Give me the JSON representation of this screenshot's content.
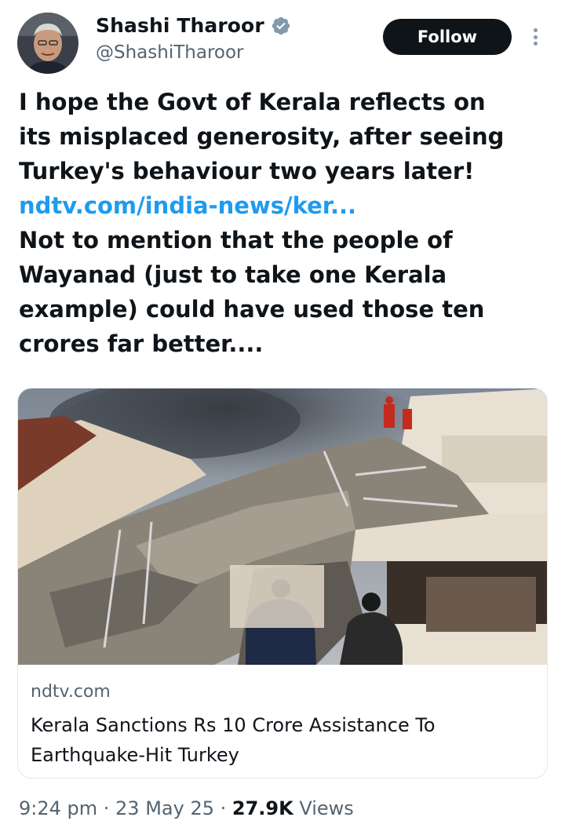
{
  "author": {
    "display_name": "Shashi Tharoor",
    "handle": "@ShashiTharoor",
    "verified_icon": "verified-badge-icon",
    "avatar_icon": "profile-photo"
  },
  "header": {
    "follow_label": "Follow",
    "more_icon": "more-options-icon"
  },
  "tweet": {
    "lines": [
      "I hope the Govt of Kerala reflects on",
      "its misplaced generosity, after seeing",
      "Turkey's behaviour two years later!"
    ],
    "link_text": "ndtv.com/india-news/ker...",
    "lines_after": [
      "Not to mention that the people of",
      "Wayanad (just to take one Kerala",
      "example) could have used those ten",
      "crores far better...."
    ]
  },
  "card": {
    "image_alt": "earthquake-collapsed-building-photo",
    "domain": "ndtv.com",
    "title_lines": [
      "Kerala Sanctions Rs 10 Crore Assistance To",
      "Earthquake-Hit Turkey"
    ]
  },
  "meta": {
    "time": "9:24 pm",
    "separator": " · ",
    "date": "23 May 25",
    "views_count": "27.9K",
    "views_label": "Views"
  },
  "colors": {
    "link": "#1d9bf0",
    "secondary_text": "#536471",
    "primary_text": "#0f1419",
    "verified": "#829aab"
  }
}
